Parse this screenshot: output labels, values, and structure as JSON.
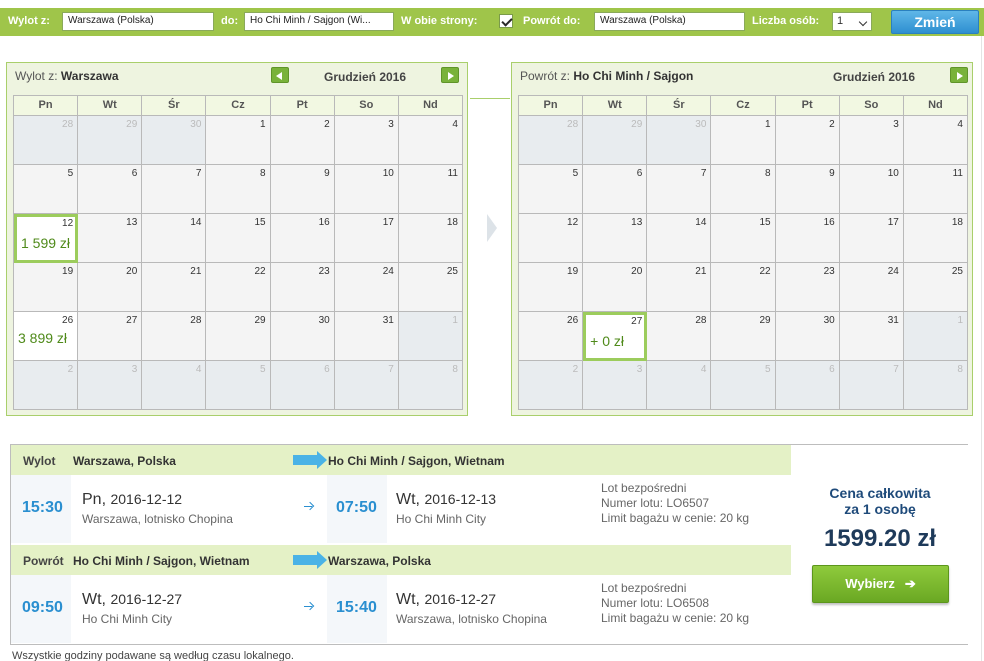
{
  "search": {
    "from_label": "Wylot z:",
    "from_value": "Warszawa (Polska)",
    "to_label": "do:",
    "to_value": "Ho Chi Minh / Sajgon (Wi...",
    "roundtrip_label": "W obie strony:",
    "return_label": "Powrót do:",
    "return_value": "Warszawa (Polska)",
    "persons_label": "Liczba osób:",
    "persons_value": "1",
    "change_button": "Zmień"
  },
  "outbound_calendar": {
    "who_prefix": "Wylot z:",
    "who_city": "Warszawa",
    "month": "Grudzień 2016",
    "dow": [
      "Pn",
      "Wt",
      "Śr",
      "Cz",
      "Pt",
      "So",
      "Nd"
    ],
    "weeks": [
      [
        {
          "d": "28",
          "dim": true
        },
        {
          "d": "29",
          "dim": true
        },
        {
          "d": "30",
          "dim": true
        },
        {
          "d": "1"
        },
        {
          "d": "2"
        },
        {
          "d": "3"
        },
        {
          "d": "4"
        }
      ],
      [
        {
          "d": "5"
        },
        {
          "d": "6"
        },
        {
          "d": "7"
        },
        {
          "d": "8"
        },
        {
          "d": "9"
        },
        {
          "d": "10"
        },
        {
          "d": "11"
        }
      ],
      [
        {
          "d": "12",
          "price": "1 599 zł",
          "sel": true
        },
        {
          "d": "13"
        },
        {
          "d": "14"
        },
        {
          "d": "15"
        },
        {
          "d": "16"
        },
        {
          "d": "17"
        },
        {
          "d": "18"
        }
      ],
      [
        {
          "d": "19"
        },
        {
          "d": "20"
        },
        {
          "d": "21"
        },
        {
          "d": "22"
        },
        {
          "d": "23"
        },
        {
          "d": "24"
        },
        {
          "d": "25"
        }
      ],
      [
        {
          "d": "26",
          "price": "3 899 zł",
          "alt": true
        },
        {
          "d": "27"
        },
        {
          "d": "28"
        },
        {
          "d": "29"
        },
        {
          "d": "30"
        },
        {
          "d": "31"
        },
        {
          "d": "1",
          "dim": true
        }
      ],
      [
        {
          "d": "2",
          "dim": true
        },
        {
          "d": "3",
          "dim": true
        },
        {
          "d": "4",
          "dim": true
        },
        {
          "d": "5",
          "dim": true
        },
        {
          "d": "6",
          "dim": true
        },
        {
          "d": "7",
          "dim": true
        },
        {
          "d": "8",
          "dim": true
        }
      ]
    ]
  },
  "return_calendar": {
    "who_prefix": "Powrót z:",
    "who_city": "Ho Chi Minh / Sajgon",
    "month": "Grudzień 2016",
    "dow": [
      "Pn",
      "Wt",
      "Śr",
      "Cz",
      "Pt",
      "So",
      "Nd"
    ],
    "weeks": [
      [
        {
          "d": "28",
          "dim": true
        },
        {
          "d": "29",
          "dim": true
        },
        {
          "d": "30",
          "dim": true
        },
        {
          "d": "1"
        },
        {
          "d": "2"
        },
        {
          "d": "3"
        },
        {
          "d": "4"
        }
      ],
      [
        {
          "d": "5"
        },
        {
          "d": "6"
        },
        {
          "d": "7"
        },
        {
          "d": "8"
        },
        {
          "d": "9"
        },
        {
          "d": "10"
        },
        {
          "d": "11"
        }
      ],
      [
        {
          "d": "12"
        },
        {
          "d": "13"
        },
        {
          "d": "14"
        },
        {
          "d": "15"
        },
        {
          "d": "16"
        },
        {
          "d": "17"
        },
        {
          "d": "18"
        }
      ],
      [
        {
          "d": "19"
        },
        {
          "d": "20"
        },
        {
          "d": "21"
        },
        {
          "d": "22"
        },
        {
          "d": "23"
        },
        {
          "d": "24"
        },
        {
          "d": "25"
        }
      ],
      [
        {
          "d": "26"
        },
        {
          "d": "27",
          "price": "+ 0 zł",
          "sel": true
        },
        {
          "d": "28"
        },
        {
          "d": "29"
        },
        {
          "d": "30"
        },
        {
          "d": "31"
        },
        {
          "d": "1",
          "dim": true
        }
      ],
      [
        {
          "d": "2",
          "dim": true
        },
        {
          "d": "3",
          "dim": true
        },
        {
          "d": "4",
          "dim": true
        },
        {
          "d": "5",
          "dim": true
        },
        {
          "d": "6",
          "dim": true
        },
        {
          "d": "7",
          "dim": true
        },
        {
          "d": "8",
          "dim": true
        }
      ]
    ]
  },
  "outbound_leg": {
    "tag": "Wylot",
    "from": "Warszawa, Polska",
    "to": "Ho Chi Minh / Sajgon, Wietnam",
    "dep_time": "15:30",
    "dep_day": "Pn,",
    "dep_date": "2016-12-12",
    "dep_place": "Warszawa, lotnisko Chopina",
    "arr_time": "07:50",
    "arr_day": "Wt,",
    "arr_date": "2016-12-13",
    "arr_place": "Ho Chi Minh City",
    "info1": "Lot bezpośredni",
    "info2": "Numer lotu: LO6507",
    "info3": "Limit bagażu w cenie: 20 kg"
  },
  "return_leg": {
    "tag": "Powrót",
    "from": "Ho Chi Minh / Sajgon, Wietnam",
    "to": "Warszawa, Polska",
    "dep_time": "09:50",
    "dep_day": "Wt,",
    "dep_date": "2016-12-27",
    "dep_place": "Ho Chi Minh City",
    "arr_time": "15:40",
    "arr_day": "Wt,",
    "arr_date": "2016-12-27",
    "arr_place": "Warszawa, lotnisko Chopina",
    "info1": "Lot bezpośredni",
    "info2": "Numer lotu: LO6508",
    "info3": "Limit bagażu w cenie: 20 kg"
  },
  "price": {
    "caption_line1": "Cena całkowita",
    "caption_line2": "za 1 osobę",
    "total": "1599.20 zł",
    "choose_button": "Wybierz"
  },
  "footnote": "Wszystkie godziny podawane są według czasu lokalnego.",
  "colors": {
    "bar_green": "#9fc54a",
    "price_green": "#4f8a1a",
    "time_blue": "#2a8fd0",
    "total_navy": "#1e3a5a"
  }
}
